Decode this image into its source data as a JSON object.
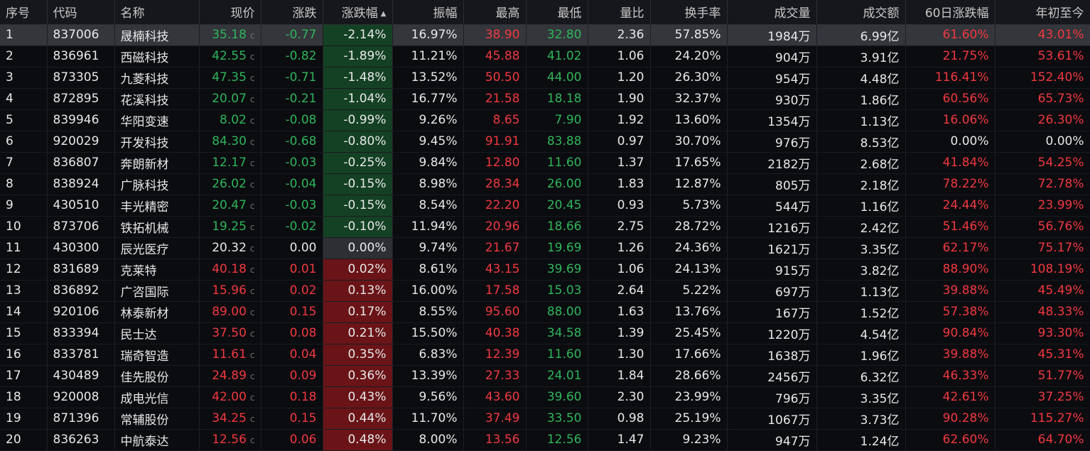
{
  "headers": {
    "index": "序号",
    "code": "代码",
    "name": "名称",
    "price": "现价",
    "change": "涨跌",
    "pct": "涨跌幅",
    "amplitude": "振幅",
    "high": "最高",
    "low": "最低",
    "vol_ratio": "量比",
    "turnover": "换手率",
    "volume": "成交量",
    "amount": "成交额",
    "d60": "60日涨跌幅",
    "ytd": "年初至今"
  },
  "sort_icon": "sort-up-triangle",
  "colors": {
    "up": "#f0393f",
    "down": "#2fb55a",
    "up_bg": "#6a1418",
    "down_bg": "#144124",
    "flat_bg": "#2e2f34"
  },
  "rows": [
    {
      "index": "1",
      "code": "837006",
      "name": "晟楠科技",
      "price": "35.18",
      "price_mark": "c",
      "change": "-0.77",
      "pct": "-2.14%",
      "amplitude": "16.97%",
      "high": "38.90",
      "low": "32.80",
      "vol_ratio": "2.36",
      "turnover": "57.85%",
      "volume": "1984万",
      "amount": "6.99亿",
      "d60": "61.60%",
      "ytd": "43.01%"
    },
    {
      "index": "2",
      "code": "836961",
      "name": "西磁科技",
      "price": "42.55",
      "price_mark": "c",
      "change": "-0.82",
      "pct": "-1.89%",
      "amplitude": "11.21%",
      "high": "45.88",
      "low": "41.02",
      "vol_ratio": "1.06",
      "turnover": "24.20%",
      "volume": "904万",
      "amount": "3.91亿",
      "d60": "21.75%",
      "ytd": "53.61%"
    },
    {
      "index": "3",
      "code": "873305",
      "name": "九菱科技",
      "price": "47.35",
      "price_mark": "c",
      "change": "-0.71",
      "pct": "-1.48%",
      "amplitude": "13.52%",
      "high": "50.50",
      "low": "44.00",
      "vol_ratio": "1.20",
      "turnover": "26.30%",
      "volume": "954万",
      "amount": "4.48亿",
      "d60": "116.41%",
      "ytd": "152.40%"
    },
    {
      "index": "4",
      "code": "872895",
      "name": "花溪科技",
      "price": "20.07",
      "price_mark": "c",
      "change": "-0.21",
      "pct": "-1.04%",
      "amplitude": "16.77%",
      "high": "21.58",
      "low": "18.18",
      "vol_ratio": "1.90",
      "turnover": "32.37%",
      "volume": "930万",
      "amount": "1.86亿",
      "d60": "60.56%",
      "ytd": "65.73%"
    },
    {
      "index": "5",
      "code": "839946",
      "name": "华阳变速",
      "price": "8.02",
      "price_mark": "c",
      "change": "-0.08",
      "pct": "-0.99%",
      "amplitude": "9.26%",
      "high": "8.65",
      "low": "7.90",
      "vol_ratio": "1.92",
      "turnover": "13.60%",
      "volume": "1354万",
      "amount": "1.13亿",
      "d60": "16.06%",
      "ytd": "26.30%"
    },
    {
      "index": "6",
      "code": "920029",
      "name": "开发科技",
      "price": "84.30",
      "price_mark": "c",
      "change": "-0.68",
      "pct": "-0.80%",
      "amplitude": "9.45%",
      "high": "91.91",
      "low": "83.88",
      "vol_ratio": "0.97",
      "turnover": "30.70%",
      "volume": "976万",
      "amount": "8.53亿",
      "d60": "0.00%",
      "ytd": "0.00%"
    },
    {
      "index": "7",
      "code": "836807",
      "name": "奔朗新材",
      "price": "12.17",
      "price_mark": "c",
      "change": "-0.03",
      "pct": "-0.25%",
      "amplitude": "9.84%",
      "high": "12.80",
      "low": "11.60",
      "vol_ratio": "1.37",
      "turnover": "17.65%",
      "volume": "2182万",
      "amount": "2.68亿",
      "d60": "41.84%",
      "ytd": "54.25%"
    },
    {
      "index": "8",
      "code": "838924",
      "name": "广脉科技",
      "price": "26.02",
      "price_mark": "c",
      "change": "-0.04",
      "pct": "-0.15%",
      "amplitude": "8.98%",
      "high": "28.34",
      "low": "26.00",
      "vol_ratio": "1.83",
      "turnover": "12.87%",
      "volume": "805万",
      "amount": "2.18亿",
      "d60": "78.22%",
      "ytd": "72.78%"
    },
    {
      "index": "9",
      "code": "430510",
      "name": "丰光精密",
      "price": "20.47",
      "price_mark": "c",
      "change": "-0.03",
      "pct": "-0.15%",
      "amplitude": "8.54%",
      "high": "22.20",
      "low": "20.45",
      "vol_ratio": "0.93",
      "turnover": "5.73%",
      "volume": "544万",
      "amount": "1.16亿",
      "d60": "24.44%",
      "ytd": "23.99%"
    },
    {
      "index": "10",
      "code": "873706",
      "name": "铁拓机械",
      "price": "19.25",
      "price_mark": "c",
      "change": "-0.02",
      "pct": "-0.10%",
      "amplitude": "11.94%",
      "high": "20.96",
      "low": "18.66",
      "vol_ratio": "2.75",
      "turnover": "28.72%",
      "volume": "1216万",
      "amount": "2.42亿",
      "d60": "51.46%",
      "ytd": "56.76%"
    },
    {
      "index": "11",
      "code": "430300",
      "name": "辰光医疗",
      "price": "20.32",
      "price_mark": "c",
      "change": "0.00",
      "pct": "0.00%",
      "amplitude": "9.74%",
      "high": "21.67",
      "low": "19.69",
      "vol_ratio": "1.26",
      "turnover": "24.36%",
      "volume": "1621万",
      "amount": "3.35亿",
      "d60": "62.17%",
      "ytd": "75.17%"
    },
    {
      "index": "12",
      "code": "831689",
      "name": "克莱特",
      "price": "40.18",
      "price_mark": "c",
      "change": "0.01",
      "pct": "0.02%",
      "amplitude": "8.61%",
      "high": "43.15",
      "low": "39.69",
      "vol_ratio": "1.06",
      "turnover": "24.13%",
      "volume": "915万",
      "amount": "3.82亿",
      "d60": "88.90%",
      "ytd": "108.19%"
    },
    {
      "index": "13",
      "code": "836892",
      "name": "广咨国际",
      "price": "15.96",
      "price_mark": "c",
      "change": "0.02",
      "pct": "0.13%",
      "amplitude": "16.00%",
      "high": "17.58",
      "low": "15.03",
      "vol_ratio": "2.64",
      "turnover": "5.22%",
      "volume": "697万",
      "amount": "1.13亿",
      "d60": "39.88%",
      "ytd": "45.49%"
    },
    {
      "index": "14",
      "code": "920106",
      "name": "林泰新材",
      "price": "89.00",
      "price_mark": "c",
      "change": "0.15",
      "pct": "0.17%",
      "amplitude": "8.55%",
      "high": "95.60",
      "low": "88.00",
      "vol_ratio": "1.63",
      "turnover": "13.76%",
      "volume": "167万",
      "amount": "1.52亿",
      "d60": "57.38%",
      "ytd": "48.33%"
    },
    {
      "index": "15",
      "code": "833394",
      "name": "民士达",
      "price": "37.50",
      "price_mark": "c",
      "change": "0.08",
      "pct": "0.21%",
      "amplitude": "15.50%",
      "high": "40.38",
      "low": "34.58",
      "vol_ratio": "1.39",
      "turnover": "25.45%",
      "volume": "1220万",
      "amount": "4.54亿",
      "d60": "90.84%",
      "ytd": "93.30%"
    },
    {
      "index": "16",
      "code": "833781",
      "name": "瑞奇智造",
      "price": "11.61",
      "price_mark": "c",
      "change": "0.04",
      "pct": "0.35%",
      "amplitude": "6.83%",
      "high": "12.39",
      "low": "11.60",
      "vol_ratio": "1.30",
      "turnover": "17.66%",
      "volume": "1638万",
      "amount": "1.96亿",
      "d60": "39.88%",
      "ytd": "45.31%"
    },
    {
      "index": "17",
      "code": "430489",
      "name": "佳先股份",
      "price": "24.89",
      "price_mark": "c",
      "change": "0.09",
      "pct": "0.36%",
      "amplitude": "13.39%",
      "high": "27.33",
      "low": "24.01",
      "vol_ratio": "1.84",
      "turnover": "28.66%",
      "volume": "2456万",
      "amount": "6.32亿",
      "d60": "46.33%",
      "ytd": "51.77%"
    },
    {
      "index": "18",
      "code": "920008",
      "name": "成电光信",
      "price": "42.00",
      "price_mark": "c",
      "change": "0.18",
      "pct": "0.43%",
      "amplitude": "9.56%",
      "high": "43.60",
      "low": "39.60",
      "vol_ratio": "2.30",
      "turnover": "23.99%",
      "volume": "796万",
      "amount": "3.35亿",
      "d60": "42.61%",
      "ytd": "37.25%"
    },
    {
      "index": "19",
      "code": "871396",
      "name": "常辅股份",
      "price": "34.25",
      "price_mark": "c",
      "change": "0.15",
      "pct": "0.44%",
      "amplitude": "11.70%",
      "high": "37.49",
      "low": "33.50",
      "vol_ratio": "0.98",
      "turnover": "25.19%",
      "volume": "1067万",
      "amount": "3.73亿",
      "d60": "90.28%",
      "ytd": "115.27%"
    },
    {
      "index": "20",
      "code": "836263",
      "name": "中航泰达",
      "price": "12.56",
      "price_mark": "c",
      "change": "0.06",
      "pct": "0.48%",
      "amplitude": "8.00%",
      "high": "13.56",
      "low": "12.56",
      "vol_ratio": "1.47",
      "turnover": "9.23%",
      "volume": "947万",
      "amount": "1.24亿",
      "d60": "62.60%",
      "ytd": "64.70%"
    }
  ]
}
